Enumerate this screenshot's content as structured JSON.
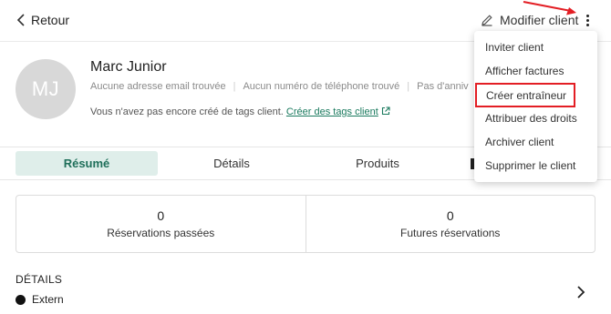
{
  "topbar": {
    "back_label": "Retour",
    "edit_label": "Modifier client"
  },
  "client": {
    "initials": "MJ",
    "name": "Marc Junior",
    "meta": [
      "Aucune adresse email trouvée",
      "Aucun numéro de téléphone trouvé",
      "Pas d'anniv"
    ],
    "tags_text": "Vous n'avez pas encore créé de tags client.",
    "tags_link": "Créer des tags client"
  },
  "tabs": [
    "Résumé",
    "Détails",
    "Produits"
  ],
  "stats": [
    {
      "value": "0",
      "label": "Réservations passées"
    },
    {
      "value": "0",
      "label": "Futures réservations"
    }
  ],
  "details": {
    "title": "DÉTAILS",
    "item": "Extern"
  },
  "menu": {
    "items": [
      "Inviter client",
      "Afficher factures",
      "Créer entraîneur",
      "Attribuer des droits",
      "Archiver client",
      "Supprimer le client"
    ],
    "highlighted_index": 2
  },
  "colors": {
    "accent": "#1a7a5e",
    "tab_active_bg": "#dfeeea",
    "highlight": "#e31e24",
    "avatar_bg": "#d8d8d8"
  }
}
